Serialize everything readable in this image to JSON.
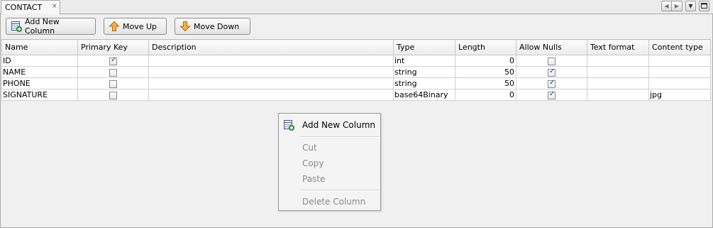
{
  "tab": {
    "title": "CONTACT",
    "close_glyph": "×"
  },
  "toolbar": {
    "add_column": "Add New Column",
    "move_up": "Move Up",
    "move_down": "Move Down"
  },
  "table": {
    "columns": [
      "Name",
      "Primary Key",
      "Description",
      "Type",
      "Length",
      "Allow Nulls",
      "Text format",
      "Content type"
    ],
    "rows": [
      {
        "name": "ID",
        "primary_key": true,
        "description": "",
        "type": "int",
        "length": "0",
        "allow_nulls": false,
        "text_format": "",
        "content_type": ""
      },
      {
        "name": "NAME",
        "primary_key": false,
        "description": "",
        "type": "string",
        "length": "50",
        "allow_nulls": true,
        "text_format": "",
        "content_type": ""
      },
      {
        "name": "PHONE",
        "primary_key": false,
        "description": "",
        "type": "string",
        "length": "50",
        "allow_nulls": true,
        "text_format": "",
        "content_type": ""
      },
      {
        "name": "SIGNATURE",
        "primary_key": false,
        "description": "",
        "type": "base64Binary",
        "length": "0",
        "allow_nulls": true,
        "text_format": "",
        "content_type": "jpg"
      }
    ]
  },
  "context_menu": {
    "add_column": "Add New Column",
    "cut": "Cut",
    "copy": "Copy",
    "paste": "Paste",
    "delete_column": "Delete Column"
  },
  "icons": {
    "add_column": "add-column-icon",
    "move_up": "arrow-up-icon",
    "move_down": "arrow-down-icon"
  },
  "colors": {
    "arrow_orange": "#f0a030",
    "add_green": "#3aa33a",
    "check_blue": "#1d3c78"
  }
}
